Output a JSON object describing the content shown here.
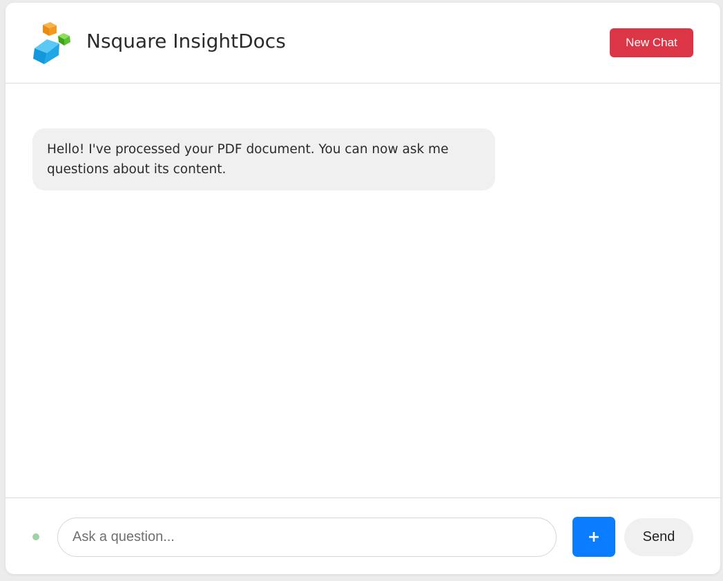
{
  "header": {
    "title": "Nsquare InsightDocs",
    "new_chat_label": "New Chat",
    "logo_icon": "stacked-cubes-logo-icon"
  },
  "messages": [
    {
      "role": "assistant",
      "text": "Hello! I've processed your PDF document. You can now ask me questions about its content."
    }
  ],
  "composer": {
    "placeholder": "Ask a question...",
    "value": "",
    "attach_label": "+",
    "send_label": "Send",
    "status_color": "#9fd3a6"
  },
  "colors": {
    "new_chat_bg": "#dc3545",
    "attach_bg": "#0a7cff",
    "bubble_bg": "#f0f0f0",
    "logo_orange": "#f39a1e",
    "logo_green": "#58c22f",
    "logo_blue": "#1fa7e8"
  }
}
